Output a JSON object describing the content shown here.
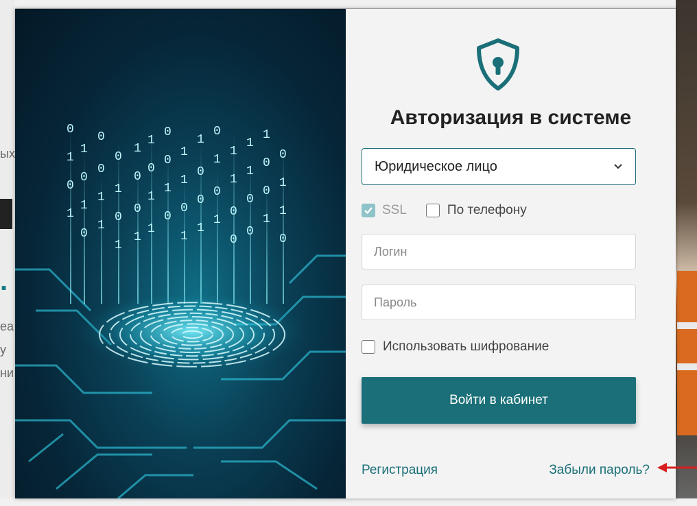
{
  "background": {
    "left_fragments": [
      "ых",
      "ea",
      "y",
      "ни"
    ]
  },
  "login": {
    "title": "Авторизация в системе",
    "entity_select": {
      "selected": "Юридическое лицо"
    },
    "ssl_label": "SSL",
    "ssl_checked": true,
    "phone_label": "По телефону",
    "phone_checked": false,
    "login_placeholder": "Логин",
    "password_placeholder": "Пароль",
    "encryption_label": "Использовать шифрование",
    "encryption_checked": false,
    "submit_label": "Войти в кабинет",
    "register_link": "Регистрация",
    "forgot_link": "Забыли пароль?"
  },
  "colors": {
    "accent": "#1a6f78",
    "panel": "#f3f3f3",
    "annotation_arrow": "#d81e1e"
  },
  "icons": [
    "shield-keyhole-icon",
    "chevron-down-icon",
    "checkmark-icon",
    "red-arrow-icon"
  ]
}
